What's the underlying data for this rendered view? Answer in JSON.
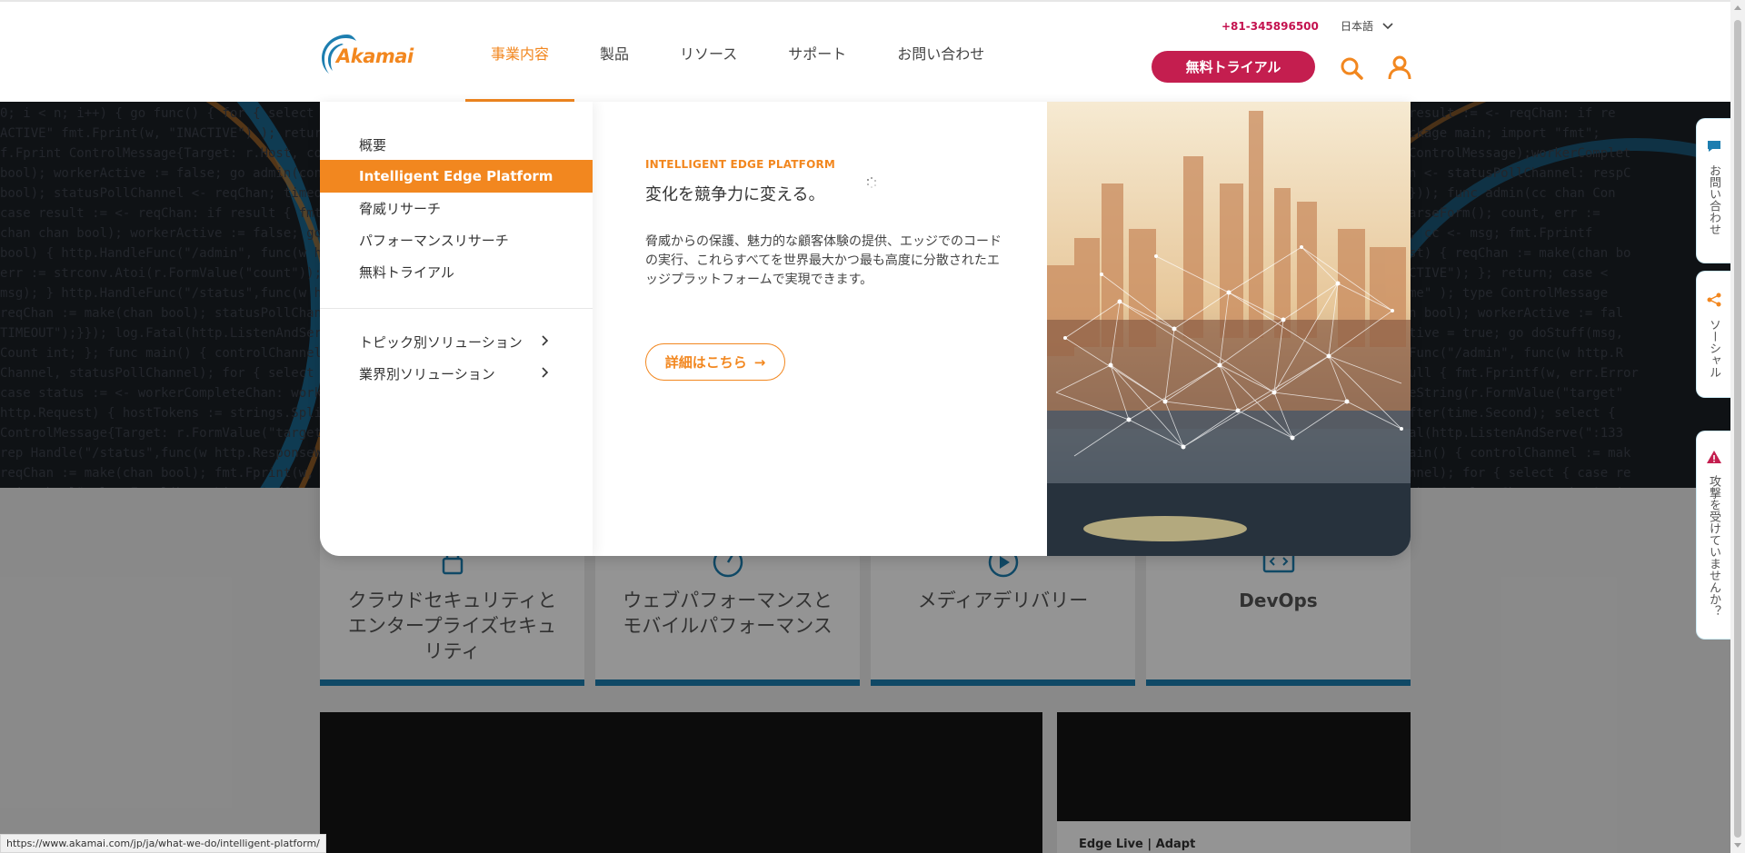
{
  "header": {
    "logo_text": "Akamai",
    "nav": [
      {
        "label": "事業内容",
        "active": true
      },
      {
        "label": "製品",
        "active": false
      },
      {
        "label": "リソース",
        "active": false
      },
      {
        "label": "サポート",
        "active": false
      },
      {
        "label": "お問い合わせ",
        "active": false
      }
    ],
    "phone": "+81-345896500",
    "language": "日本語",
    "trial_label": "無料トライアル"
  },
  "mega_menu": {
    "left_items": [
      {
        "label": "概要",
        "active": false
      },
      {
        "label": "Intelligent Edge Platform",
        "active": true
      },
      {
        "label": "脅威リサーチ",
        "active": false
      },
      {
        "label": "パフォーマンスリサーチ",
        "active": false
      },
      {
        "label": "無料トライアル",
        "active": false
      }
    ],
    "solution_items": [
      {
        "label": "トピック別ソリューション"
      },
      {
        "label": "業界別ソリューション"
      }
    ],
    "eyebrow": "INTELLIGENT EDGE PLATFORM",
    "heading": "変化を競争力に変える。",
    "description": "脅威からの保護、魅力的な顧客体験の提供、エッジでのコードの実行、これらすべてを世界最大かつ最も高度に分散されたエッジプラットフォームで実現できます。",
    "cta_label": "詳細はこちら",
    "cta_arrow": "→"
  },
  "cards": [
    {
      "title": "クラウドセキュリティとエンタープライズセキュリティ",
      "icon": "lock-icon"
    },
    {
      "title": "ウェブパフォーマンスとモバイルパフォーマンス",
      "icon": "gauge-icon"
    },
    {
      "title": "メディアデリバリー",
      "icon": "play-icon"
    },
    {
      "title": "DevOps",
      "icon": "code-icon"
    }
  ],
  "video_caption": "Edge Live | Adapt",
  "side_tabs": [
    {
      "label": "お問い合わせ",
      "icon": "chat-icon"
    },
    {
      "label": "ソーシャル",
      "icon": "share-icon"
    },
    {
      "label": "攻撃を受けていませんか？",
      "icon": "warning-icon"
    }
  ],
  "status_url": "https://www.akamai.com/jp/ja/what-we-do/intelligent-platform/",
  "colors": {
    "accent": "#f2871f",
    "brand_red": "#c41e4f",
    "card_border": "#1d7eb0"
  }
}
